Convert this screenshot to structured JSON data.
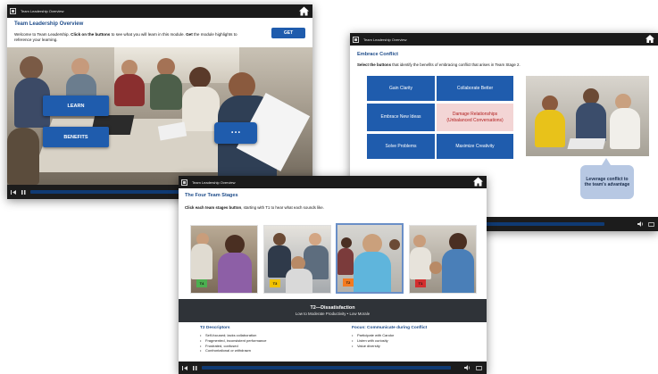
{
  "win1": {
    "title_bar": "Team Leadership Overview",
    "heading": "Team Leadership Overview",
    "intro_1": "Welcome to Team Leadership. ",
    "intro_bold": "Click on the buttons",
    "intro_2": " to see what you will learn in this module. ",
    "intro_bold2": "Get",
    "intro_3": " the module highlights to reference your learning.",
    "get_label": "GET",
    "learn_label": "LEARN",
    "benefits_label": "BENEFITS",
    "more_label": "• • •"
  },
  "win2": {
    "title_bar": "Team Leadership Overview",
    "heading": "Embrace Conflict",
    "instr_bold": "Select the buttons",
    "instr_rest": " that identify the benefits of embracing conflict that arises in Team Stage 2.",
    "options": [
      "Gain Clarity",
      "Collaborate Better",
      "Embrace New Ideas",
      "Damage Relationships (Unbalanced Conversations)",
      "Solve Problems",
      "Maximize Creativity"
    ],
    "callout": "Leverage conflict to the team's advantage"
  },
  "win3": {
    "title_bar": "Team Leadership Overview",
    "heading": "The Four Team Stages",
    "instr_bold": "Click each team stages button",
    "instr_rest": ", starting with T1 to hear what each sounds like.",
    "stages": [
      {
        "label": "T4",
        "color": "#4caf50"
      },
      {
        "label": "T3",
        "color": "#f2c200"
      },
      {
        "label": "T2",
        "color": "#f47a20"
      },
      {
        "label": "T1",
        "color": "#d32f2f"
      }
    ],
    "banner_title": "T2—Dissatisfaction",
    "banner_sub": "Low to Moderate Productivity • Low Morale",
    "desc_heading": "T2 Descriptors",
    "descriptors": [
      "Self-focused; lacks collaboration",
      "Fragmented, inconsistent performance",
      "Frustrated, confused",
      "Confrontational or withdrawn"
    ],
    "focus_heading": "Focus: Communicate during Conflict",
    "focus_items": [
      "Participate with Candor",
      "Listen with curiosity",
      "Value diversity"
    ]
  }
}
